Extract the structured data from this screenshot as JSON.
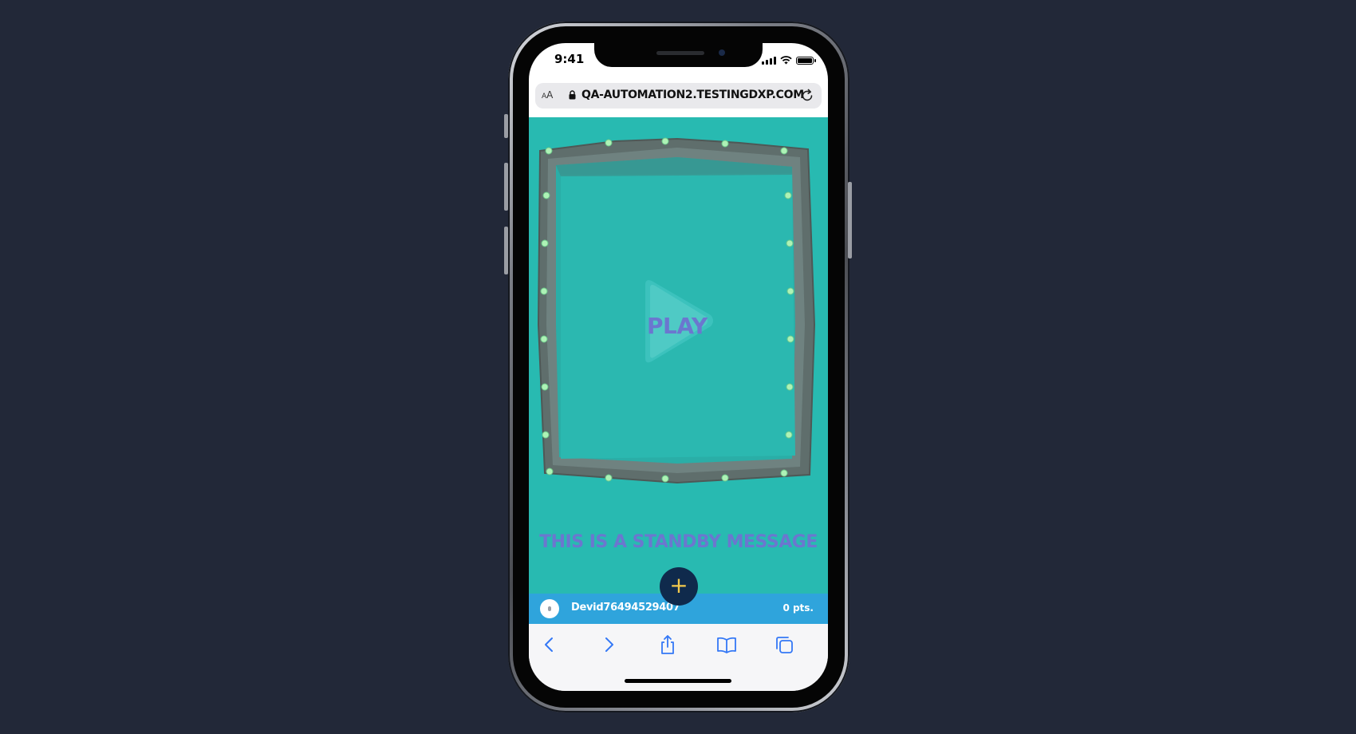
{
  "status_bar": {
    "time": "9:41"
  },
  "browser": {
    "text_size_label_small": "A",
    "text_size_label_large": "A",
    "url": "QA-AUTOMATION2.TESTINGDXP.COM"
  },
  "game": {
    "play_label": "PLAY",
    "standby_message": "THIS IS A STANDBY MESSAGE",
    "add_button_symbol": "+"
  },
  "player": {
    "username": "Devid76494529407",
    "points": "0 pts."
  },
  "toolbar": {
    "items": [
      "back",
      "forward",
      "share",
      "bookmarks",
      "tabs"
    ]
  },
  "colors": {
    "background": "#222838",
    "game_bg": "#28bab1",
    "accent_purple": "#6b77cf",
    "player_bar": "#2fa4dc",
    "fab_bg": "#0f2a4c",
    "fab_plus": "#f2c94c",
    "ios_blue": "#3478f6"
  }
}
